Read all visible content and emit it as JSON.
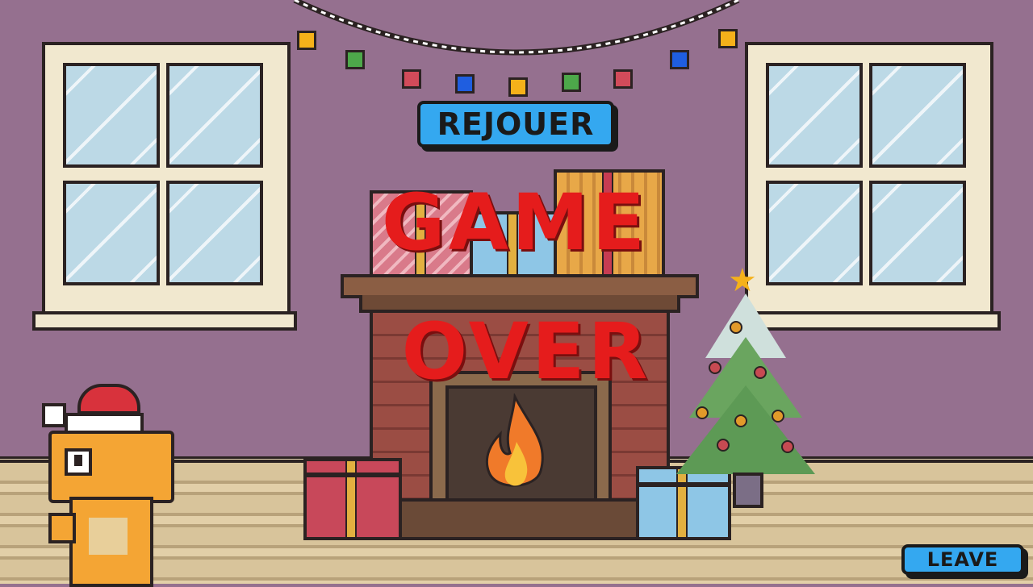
{
  "game": {
    "title_line1": "GAME",
    "title_line2": "OVER"
  },
  "buttons": {
    "replay_label": "REJOUER",
    "leave_label": "LEAVE"
  },
  "colors": {
    "wall": "#95708f",
    "button": "#34a8f0",
    "game_over_text": "#e51c1c"
  },
  "icons": [
    "string-lights-icon",
    "fireplace-flame-icon",
    "christmas-tree-icon",
    "gift-icon",
    "dinosaur-santa-hat-icon"
  ]
}
